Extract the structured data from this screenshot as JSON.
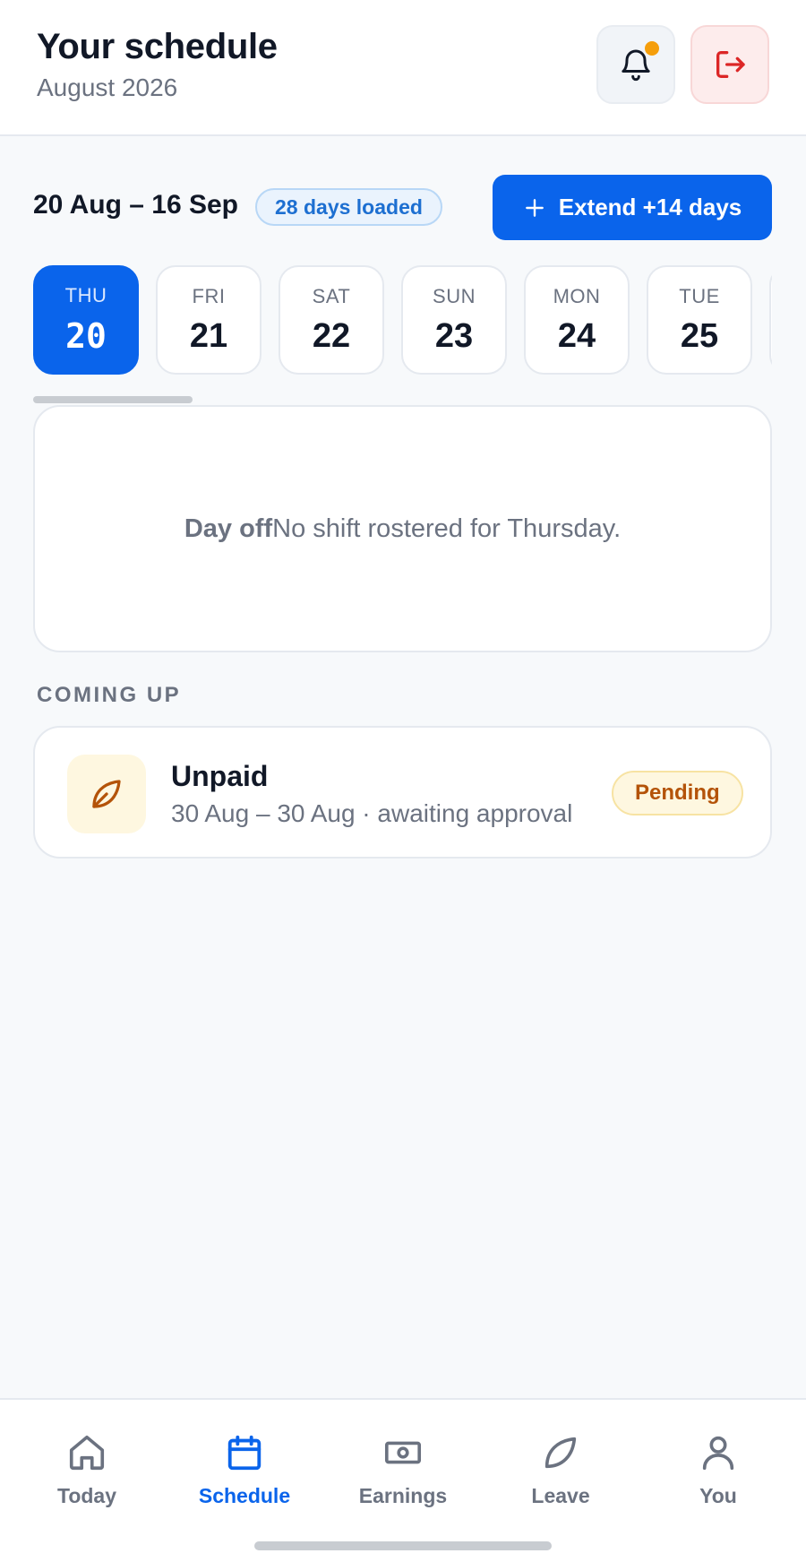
{
  "header": {
    "title": "Your schedule",
    "subtitle": "August 2026",
    "notification_icon": "bell-icon",
    "notification_dot_color": "#f59e0b",
    "logout_icon": "logout-icon"
  },
  "range": {
    "label": "20 Aug – 16 Sep",
    "loaded_badge": "28 days loaded",
    "extend_button": "Extend +14 days"
  },
  "days": [
    {
      "name": "THU",
      "num": "20",
      "active": true
    },
    {
      "name": "FRI",
      "num": "21",
      "active": false
    },
    {
      "name": "SAT",
      "num": "22",
      "active": false
    },
    {
      "name": "SUN",
      "num": "23",
      "active": false
    },
    {
      "name": "MON",
      "num": "24",
      "active": false
    },
    {
      "name": "TUE",
      "num": "25",
      "active": false
    }
  ],
  "day_off": {
    "bold": "Day off",
    "text": "No shift rostered for Thursday."
  },
  "coming_up": {
    "label": "COMING UP",
    "items": [
      {
        "icon": "leaf-icon",
        "title": "Unpaid",
        "subtitle": "30 Aug – 30 Aug · awaiting approval",
        "status": "Pending"
      }
    ]
  },
  "nav": [
    {
      "label": "Today",
      "icon": "home-icon",
      "active": false
    },
    {
      "label": "Schedule",
      "icon": "calendar-icon",
      "active": true
    },
    {
      "label": "Earnings",
      "icon": "cash-icon",
      "active": false
    },
    {
      "label": "Leave",
      "icon": "leaf-icon",
      "active": false
    },
    {
      "label": "You",
      "icon": "user-icon",
      "active": false
    }
  ],
  "colors": {
    "accent": "#0a64eb",
    "pending": "#b45309",
    "logout": "#dc2626"
  }
}
